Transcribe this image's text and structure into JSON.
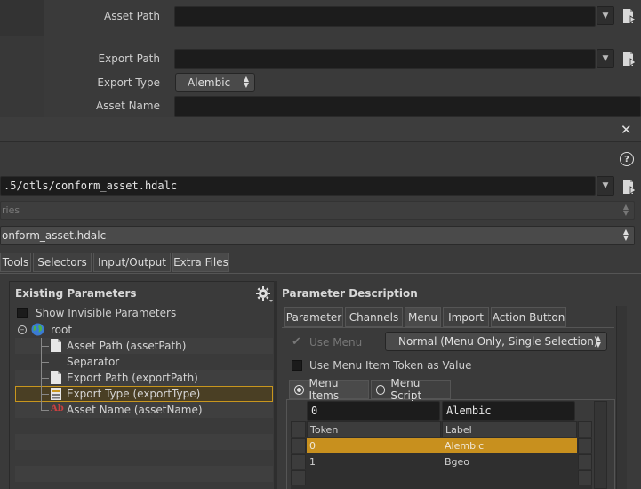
{
  "top_params": {
    "asset_path_label": "Asset Path",
    "export_path_label": "Export Path",
    "export_type_label": "Export Type",
    "export_type_value": "Alembic",
    "asset_name_label": "Asset Name"
  },
  "dialog": {
    "library_path": ".5/otls/conform_asset.hdalc",
    "category_value": "ries",
    "definition_value": "onform_asset.hdalc",
    "tabs": [
      "Tools",
      "Selectors",
      "Input/Output",
      "Extra Files"
    ],
    "help_glyph": "?",
    "close_glyph": "✕"
  },
  "existing_params": {
    "title": "Existing Parameters",
    "show_invisible_label": "Show Invisible Parameters",
    "tree": [
      {
        "label": "root"
      },
      {
        "label": "Asset Path (assetPath)"
      },
      {
        "label": "Separator"
      },
      {
        "label": "Export Path (exportPath)"
      },
      {
        "label": "Export Type (exportType)"
      },
      {
        "label": "Asset Name (assetName)"
      }
    ]
  },
  "param_desc": {
    "title": "Parameter Description",
    "tabs": [
      "Parameter",
      "Channels",
      "Menu",
      "Import",
      "Action Button"
    ],
    "use_menu_label": "Use Menu",
    "use_menu_mode": "Normal (Menu Only, Single Selection)",
    "use_token_label": "Use Menu Item Token as Value",
    "menu_items_label": "Menu Items",
    "menu_script_label": "Menu Script",
    "edit_token": "0",
    "edit_label": "Alembic",
    "col_token": "Token",
    "col_label": "Label",
    "rows": [
      {
        "token": "0",
        "label": "Alembic"
      },
      {
        "token": "1",
        "label": "Bgeo"
      }
    ]
  }
}
